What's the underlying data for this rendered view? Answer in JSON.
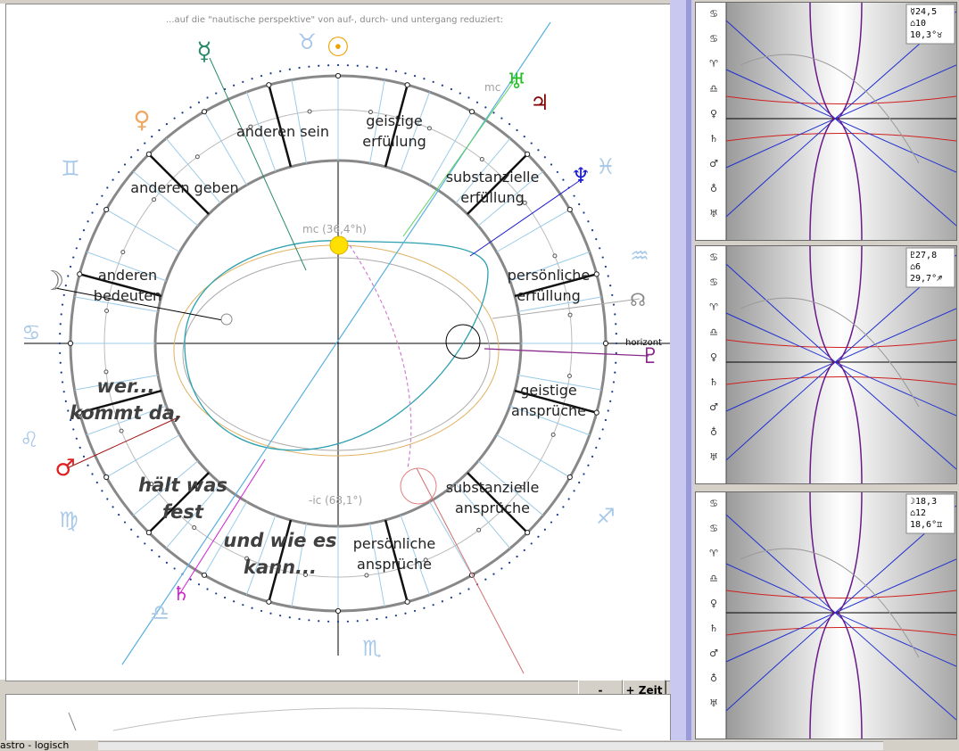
{
  "header_text": "...auf die \"nautische perspektive\" von auf-, durch- und untergang reduziert:",
  "houses": [
    {
      "line1": "geistige",
      "line2": "erfüllung"
    },
    {
      "line1": "substanzielle",
      "line2": "erfüllung"
    },
    {
      "line1": "persönliche",
      "line2": "erfüllung"
    },
    {
      "line1": "geistige",
      "line2": "ansprüche"
    },
    {
      "line1": "substanzielle",
      "line2": "ansprüche"
    },
    {
      "line1": "persönliche",
      "line2": "ansprüche"
    },
    {
      "line1": "anderen sein",
      "line2": ""
    },
    {
      "line1": "anderen geben",
      "line2": ""
    },
    {
      "line1": "anderen",
      "line2": "bedeuten"
    }
  ],
  "statements": [
    {
      "line1": "wer...",
      "line2": "kommt da,"
    },
    {
      "line1": "hält was",
      "line2": "fest"
    },
    {
      "line1": "und wie es",
      "line2": "kann..."
    }
  ],
  "axis_labels": {
    "mc_small": "mc",
    "mc_full": "mc (36,4°h)",
    "ic_full": "-ic (68,1°)",
    "horizont": "horizont"
  },
  "buttons": {
    "minus": "-",
    "zeit": "+ Zeit"
  },
  "tab_label": "astro - logisch",
  "right_panels": [
    {
      "id": "mercury",
      "line1": "☿24,5",
      "line2": "⌂10",
      "line3": "10,3°♉"
    },
    {
      "id": "pluto",
      "line1": "♇27,8",
      "line2": "⌂6",
      "line3": "29,7°♐"
    },
    {
      "id": "moon",
      "line1": "☽18,3",
      "line2": "⌂12",
      "line3": "18,6°♊"
    }
  ],
  "colors": {
    "accent_teal": "#00a0a0",
    "sun": "#f0a000",
    "mercury": "#2a8a6a",
    "mars": "#e02020",
    "jupiter": "#800000",
    "uranus": "#20c020",
    "neptune": "#1a1ad0",
    "pluto": "#8a2a8a",
    "saturn": "#d020d0",
    "panel_red": "#d02020",
    "panel_blue": "#2030d0",
    "panel_purple": "#6a1a8a"
  }
}
